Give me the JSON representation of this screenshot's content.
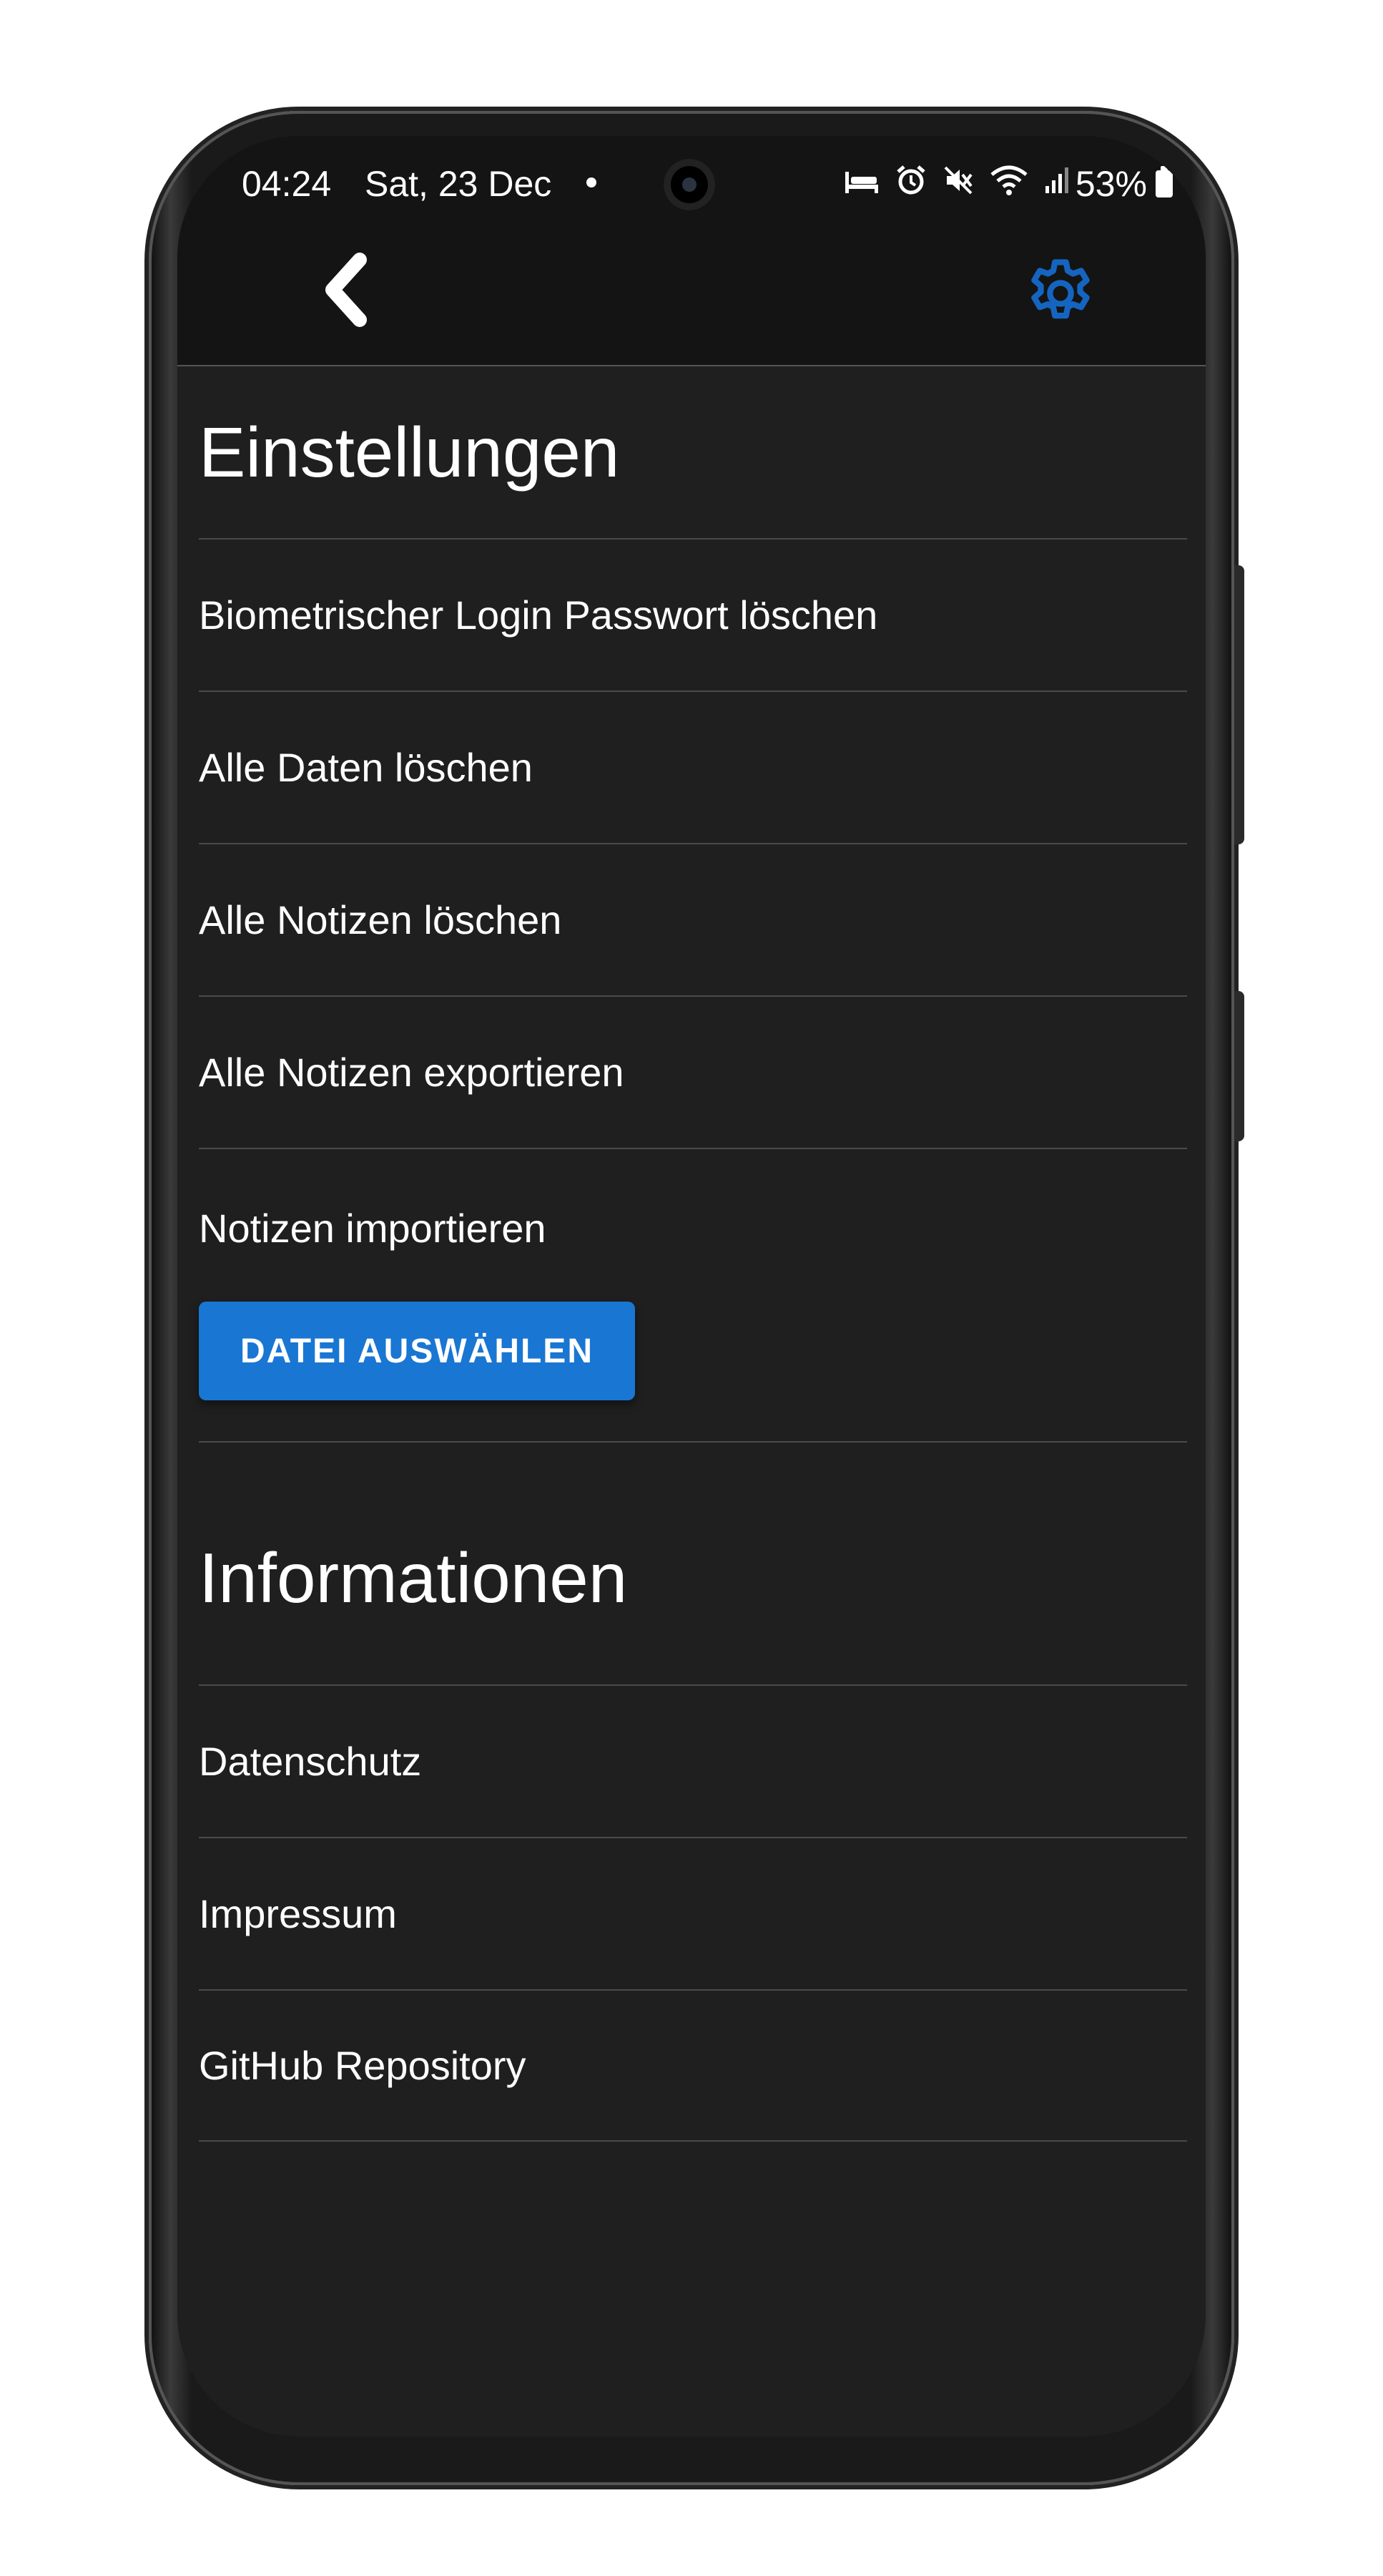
{
  "status_bar": {
    "time": "04:24",
    "date": "Sat, 23 Dec",
    "battery": "53%",
    "icons": [
      "bed-icon",
      "alarm-icon",
      "mute-icon",
      "wifi-icon",
      "signal-icon",
      "battery-icon"
    ]
  },
  "app_bar": {
    "back_icon": "chevron-left-icon",
    "settings_icon": "gear-icon",
    "accent_color": "#1976d2"
  },
  "settings": {
    "title": "Einstellungen",
    "items": [
      {
        "label": "Biometrischer Login Passwort löschen"
      },
      {
        "label": "Alle Daten löschen"
      },
      {
        "label": "Alle Notizen löschen"
      },
      {
        "label": "Alle Notizen exportieren"
      }
    ],
    "import": {
      "label": "Notizen importieren",
      "button": "DATEI AUSWÄHLEN"
    }
  },
  "info": {
    "title": "Informationen",
    "items": [
      {
        "label": "Datenschutz"
      },
      {
        "label": "Impressum"
      },
      {
        "label": "GitHub Repository"
      }
    ]
  }
}
